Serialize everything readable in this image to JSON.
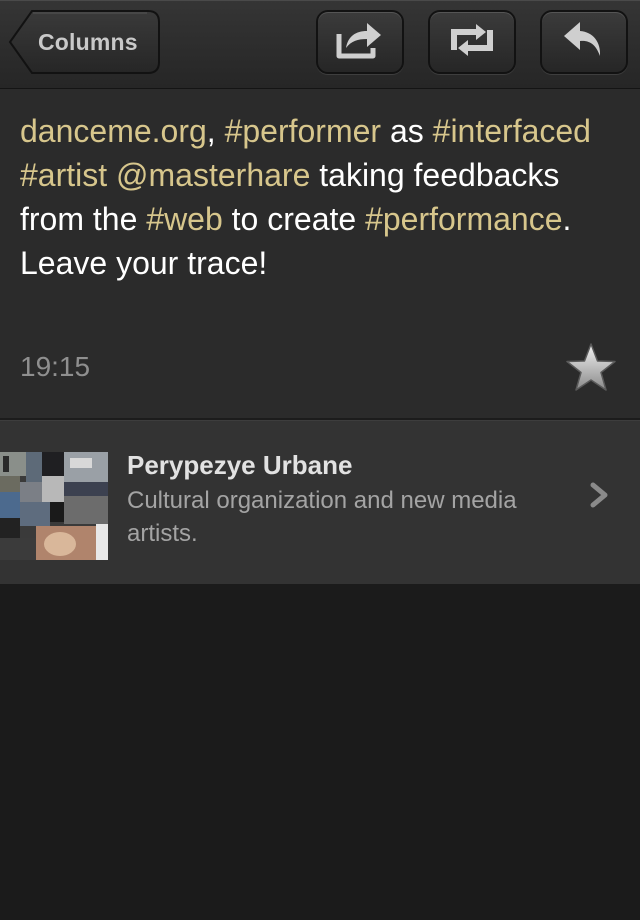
{
  "toolbar": {
    "back_label": "Columns",
    "buttons": [
      {
        "name": "share-button",
        "icon": "share-icon"
      },
      {
        "name": "retweet-button",
        "icon": "retweet-icon"
      },
      {
        "name": "reply-button",
        "icon": "reply-icon"
      }
    ]
  },
  "tweet": {
    "segments": [
      {
        "text": "danceme.org",
        "type": "link"
      },
      {
        "text": ", ",
        "type": "text"
      },
      {
        "text": "#performer",
        "type": "hashtag"
      },
      {
        "text": " as ",
        "type": "text"
      },
      {
        "text": "#interfaced",
        "type": "hashtag"
      },
      {
        "text": " ",
        "type": "text"
      },
      {
        "text": "#artist",
        "type": "hashtag"
      },
      {
        "text": " ",
        "type": "text"
      },
      {
        "text": "@masterhare",
        "type": "mention"
      },
      {
        "text": " taking feedbacks from the ",
        "type": "text"
      },
      {
        "text": "#web",
        "type": "hashtag"
      },
      {
        "text": " to create ",
        "type": "text"
      },
      {
        "text": "#performance",
        "type": "hashtag"
      },
      {
        "text": ". ",
        "type": "text"
      },
      {
        "text": "Leave your trace!",
        "type": "text"
      }
    ],
    "time": "19:15",
    "favorite_icon": "star-icon"
  },
  "profile": {
    "name": "Perypezye Urbane",
    "description": "Cultural organization and new media artists.",
    "avatar_icon": "collage-avatar",
    "chevron_icon": "chevron-right-icon"
  },
  "colors": {
    "toolbar_bg": "#2f2f2f",
    "tweet_bg": "#2b2b2b",
    "profile_bg": "#333333",
    "page_bg": "#1b1b1b",
    "highlight": "#d7c68c",
    "text": "#ffffff",
    "muted": "#8f8f8f"
  }
}
